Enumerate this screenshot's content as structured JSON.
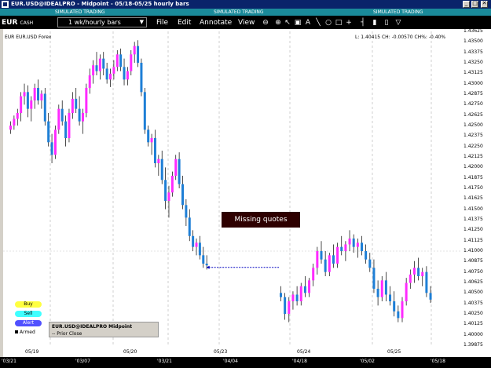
{
  "window": {
    "title": "EUR.USD@IDEALPRO - Midpoint - 05/18-05/25 hourly bars",
    "controls": [
      "_",
      "□",
      "✕"
    ]
  },
  "sim_labels": [
    "SIMULATED TRADING",
    "SIMULATED TRADING",
    "SIMULATED TRADING"
  ],
  "toolbar": {
    "symbol": "EUR",
    "symbol_type": "CASH",
    "period": "1 wk/hourly bars",
    "menus": [
      "File",
      "Edit",
      "Annotate",
      "View"
    ],
    "icons": [
      "zoom-out-icon",
      "zoom-in-icon",
      "pointer-icon",
      "camera-icon",
      "text-icon",
      "line-icon",
      "circle-icon",
      "rectangle-icon",
      "crosshair-icon",
      "bar-icon",
      "candle-icon",
      "bar-width-icon",
      "filter-icon"
    ]
  },
  "chart_header": {
    "left": "EUR EUR.USD Forex",
    "right": "L: 1.40415  CH: -0.00570  CH%: -0.40%"
  },
  "missing_label": "Missing quotes",
  "order_buttons": {
    "buy": "Buy",
    "sell": "Sell",
    "alert": "Alert",
    "armed": "Armed"
  },
  "legend": {
    "line1": "EUR.USD@IDEALPRO Midpoint",
    "line2": "-- Prior Close"
  },
  "colors": {
    "up": "#ff2aff",
    "down": "#1e7fd6",
    "gap": "#0000c0"
  },
  "chart_data": {
    "type": "candlestick",
    "y_ticks": [
      "1.43625",
      "1.43500",
      "1.43375",
      "1.43250",
      "1.43125",
      "1.43000",
      "1.42875",
      "1.42750",
      "1.42625",
      "1.42500",
      "1.42375",
      "1.42250",
      "1.42125",
      "1.42000",
      "1.41875",
      "1.41750",
      "1.41625",
      "1.41500",
      "1.41375",
      "1.41250",
      "1.41125",
      "1.41000",
      "1.40875",
      "1.40750",
      "1.40625",
      "1.40500",
      "1.40375",
      "1.40250",
      "1.40125",
      "1.40000",
      "1.39875"
    ],
    "ylim": [
      1.39875,
      1.43625
    ],
    "x_dates": [
      "05/19",
      "05/20",
      "05/23",
      "05/24",
      "05/25"
    ],
    "x_bottom": [
      "'03/21",
      "'03/07",
      "'03/21",
      "'04/04",
      "'04/18",
      "'05/02",
      "'05/18"
    ],
    "prior_close": 1.41,
    "gap_level": 1.40805,
    "candles": [
      [
        1.4245,
        1.4255,
        1.424,
        1.425
      ],
      [
        1.425,
        1.4262,
        1.4245,
        1.4258
      ],
      [
        1.4258,
        1.427,
        1.425,
        1.4265
      ],
      [
        1.4265,
        1.429,
        1.4255,
        1.4285
      ],
      [
        1.4285,
        1.43,
        1.4275,
        1.429
      ],
      [
        1.429,
        1.4298,
        1.426,
        1.427
      ],
      [
        1.427,
        1.4285,
        1.4255,
        1.428
      ],
      [
        1.428,
        1.43,
        1.427,
        1.4295
      ],
      [
        1.4295,
        1.4305,
        1.4275,
        1.428
      ],
      [
        1.428,
        1.4292,
        1.427,
        1.4288
      ],
      [
        1.4288,
        1.4295,
        1.425,
        1.4255
      ],
      [
        1.4255,
        1.4265,
        1.4225,
        1.423
      ],
      [
        1.423,
        1.424,
        1.4205,
        1.4215
      ],
      [
        1.4215,
        1.425,
        1.421,
        1.4245
      ],
      [
        1.4245,
        1.4275,
        1.424,
        1.427
      ],
      [
        1.427,
        1.428,
        1.425,
        1.4255
      ],
      [
        1.4255,
        1.4262,
        1.4225,
        1.4235
      ],
      [
        1.4235,
        1.427,
        1.423,
        1.4265
      ],
      [
        1.4265,
        1.429,
        1.4258,
        1.4282
      ],
      [
        1.4282,
        1.4295,
        1.4265,
        1.427
      ],
      [
        1.427,
        1.4285,
        1.425,
        1.4255
      ],
      [
        1.4255,
        1.427,
        1.424,
        1.4265
      ],
      [
        1.4265,
        1.43,
        1.426,
        1.4295
      ],
      [
        1.4295,
        1.4318,
        1.4288,
        1.431
      ],
      [
        1.431,
        1.4328,
        1.43,
        1.4322
      ],
      [
        1.4322,
        1.4338,
        1.431,
        1.4315
      ],
      [
        1.4315,
        1.4335,
        1.4305,
        1.433
      ],
      [
        1.433,
        1.4338,
        1.431,
        1.4318
      ],
      [
        1.4318,
        1.4325,
        1.43,
        1.4305
      ],
      [
        1.4305,
        1.4318,
        1.4296,
        1.4312
      ],
      [
        1.4312,
        1.4328,
        1.4305,
        1.432
      ],
      [
        1.432,
        1.434,
        1.4315,
        1.4335
      ],
      [
        1.4335,
        1.4342,
        1.4315,
        1.432
      ],
      [
        1.432,
        1.433,
        1.4298,
        1.4305
      ],
      [
        1.4305,
        1.432,
        1.4298,
        1.4315
      ],
      [
        1.4315,
        1.434,
        1.431,
        1.4335
      ],
      [
        1.4335,
        1.435,
        1.4325,
        1.4345
      ],
      [
        1.4345,
        1.4352,
        1.432,
        1.4325
      ],
      [
        1.4325,
        1.433,
        1.4285,
        1.429
      ],
      [
        1.429,
        1.4295,
        1.424,
        1.4245
      ],
      [
        1.4245,
        1.425,
        1.4225,
        1.423
      ],
      [
        1.423,
        1.424,
        1.4215,
        1.4235
      ],
      [
        1.4235,
        1.4245,
        1.42,
        1.4205
      ],
      [
        1.4205,
        1.4215,
        1.419,
        1.421
      ],
      [
        1.421,
        1.422,
        1.418,
        1.4185
      ],
      [
        1.4185,
        1.42,
        1.415,
        1.416
      ],
      [
        1.416,
        1.4178,
        1.414,
        1.417
      ],
      [
        1.417,
        1.4195,
        1.4165,
        1.419
      ],
      [
        1.419,
        1.4215,
        1.4185,
        1.421
      ],
      [
        1.421,
        1.4218,
        1.4175,
        1.418
      ],
      [
        1.418,
        1.419,
        1.415,
        1.4155
      ],
      [
        1.4155,
        1.4162,
        1.413,
        1.414
      ],
      [
        1.414,
        1.415,
        1.4112,
        1.4118
      ],
      [
        1.4118,
        1.4125,
        1.41,
        1.4105
      ],
      [
        1.4105,
        1.4115,
        1.4095,
        1.411
      ],
      [
        1.411,
        1.4118,
        1.409,
        1.4095
      ],
      [
        1.4095,
        1.4105,
        1.408,
        1.4085
      ],
      [
        1.4085,
        1.4095,
        1.4078,
        1.4083
      ],
      [
        1.405,
        1.4058,
        1.404,
        1.4045
      ],
      [
        1.4045,
        1.405,
        1.4018,
        1.4025
      ],
      [
        1.4025,
        1.4045,
        1.4015,
        1.404
      ],
      [
        1.404,
        1.4052,
        1.403,
        1.4048
      ],
      [
        1.4048,
        1.4058,
        1.4035,
        1.404
      ],
      [
        1.404,
        1.4062,
        1.4035,
        1.4058
      ],
      [
        1.4058,
        1.407,
        1.4045,
        1.405
      ],
      [
        1.405,
        1.4068,
        1.4045,
        1.4065
      ],
      [
        1.4065,
        1.4085,
        1.4058,
        1.408
      ],
      [
        1.408,
        1.4105,
        1.4072,
        1.41
      ],
      [
        1.41,
        1.4112,
        1.4085,
        1.409
      ],
      [
        1.409,
        1.41,
        1.407,
        1.4075
      ],
      [
        1.4075,
        1.4098,
        1.407,
        1.4095
      ],
      [
        1.4095,
        1.4108,
        1.408,
        1.4085
      ],
      [
        1.4085,
        1.411,
        1.408,
        1.4105
      ],
      [
        1.4105,
        1.4118,
        1.4095,
        1.41
      ],
      [
        1.41,
        1.4112,
        1.4088,
        1.4108
      ],
      [
        1.4108,
        1.4125,
        1.41,
        1.4115
      ],
      [
        1.4115,
        1.412,
        1.4098,
        1.4105
      ],
      [
        1.4105,
        1.4115,
        1.4092,
        1.411
      ],
      [
        1.411,
        1.4118,
        1.4095,
        1.41
      ],
      [
        1.41,
        1.4108,
        1.4085,
        1.409
      ],
      [
        1.409,
        1.4098,
        1.4075,
        1.408
      ],
      [
        1.408,
        1.409,
        1.405,
        1.4055
      ],
      [
        1.4055,
        1.4065,
        1.4035,
        1.4045
      ],
      [
        1.4045,
        1.407,
        1.404,
        1.4065
      ],
      [
        1.4065,
        1.4075,
        1.404,
        1.4048
      ],
      [
        1.4048,
        1.4058,
        1.4035,
        1.404
      ],
      [
        1.404,
        1.4052,
        1.4022,
        1.4028
      ],
      [
        1.4028,
        1.4035,
        1.4015,
        1.402
      ],
      [
        1.402,
        1.4045,
        1.4015,
        1.404
      ],
      [
        1.404,
        1.4068,
        1.4035,
        1.4062
      ],
      [
        1.4062,
        1.4078,
        1.4055,
        1.4072
      ],
      [
        1.4072,
        1.4088,
        1.4062,
        1.408
      ],
      [
        1.408,
        1.4092,
        1.4065,
        1.407
      ],
      [
        1.407,
        1.408,
        1.4058,
        1.4075
      ],
      [
        1.4075,
        1.4082,
        1.4045,
        1.405
      ],
      [
        1.405,
        1.4058,
        1.4038,
        1.4042
      ]
    ]
  }
}
